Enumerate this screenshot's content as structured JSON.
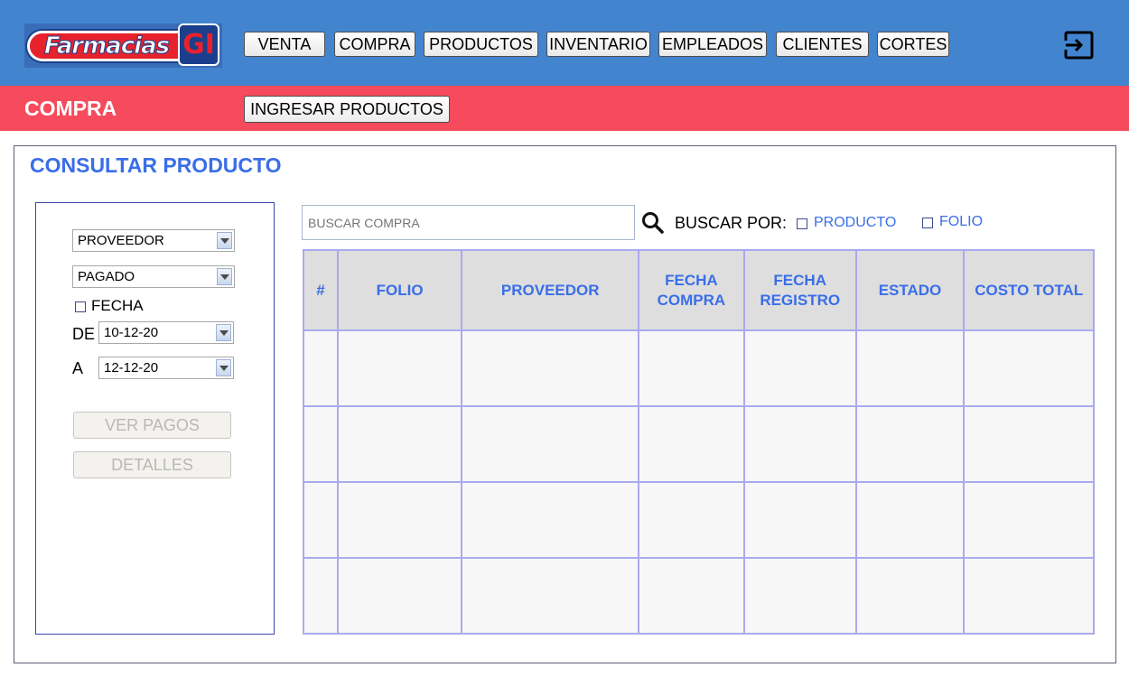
{
  "brand": {
    "logo_text": "Farmacias",
    "logo_badge": "GI"
  },
  "nav": {
    "items": [
      "VENTA",
      "COMPRA",
      "PRODUCTOS",
      "INVENTARIO",
      "EMPLEADOS",
      "CLIENTES",
      "CORTES"
    ],
    "logout_icon": "logout-icon"
  },
  "section": {
    "title": "COMPRA",
    "action_label": "INGRESAR PRODUCTOS"
  },
  "panel": {
    "title": "CONSULTAR PRODUCTO"
  },
  "filters": {
    "proveedor_value": "PROVEEDOR",
    "estado_value": "PAGADO",
    "fecha_label": "FECHA",
    "de_label": "DE",
    "de_value": "10-12-20",
    "a_label": "A",
    "a_value": "12-12-20",
    "ver_pagos_label": "VER PAGOS",
    "detalles_label": "DETALLES"
  },
  "search": {
    "placeholder": "BUSCAR COMPRA",
    "buscar_por_label": "BUSCAR POR:",
    "options": [
      "PRODUCTO",
      "FOLIO"
    ]
  },
  "table": {
    "columns": [
      "#",
      "FOLIO",
      "PROVEEDOR",
      "FECHA\nCOMPRA",
      "FECHA\nREGISTRO",
      "ESTADO",
      "COSTO TOTAL"
    ],
    "rows": [
      [
        "",
        "",
        "",
        "",
        "",
        "",
        ""
      ],
      [
        "",
        "",
        "",
        "",
        "",
        "",
        ""
      ],
      [
        "",
        "",
        "",
        "",
        "",
        "",
        ""
      ],
      [
        "",
        "",
        "",
        "",
        "",
        "",
        ""
      ]
    ]
  },
  "colors": {
    "topbar": "#4384cf",
    "section_bar": "#f54b5c",
    "accent_text": "#3a6ee8",
    "table_border": "#aaaaee",
    "table_header_bg": "#dedede"
  }
}
